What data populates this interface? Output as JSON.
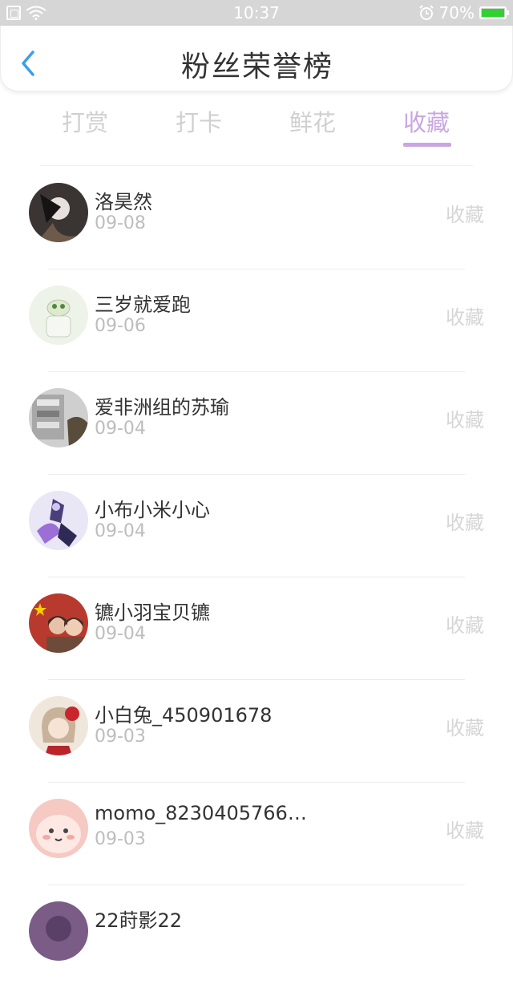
{
  "status_bar": {
    "time": "10:37",
    "battery": "70%",
    "icons": [
      "sim-icon",
      "wifi-icon",
      "alarm-icon",
      "battery-charging-icon"
    ]
  },
  "header": {
    "title": "粉丝荣誉榜",
    "back_icon": "chevron-left-icon",
    "accent_color": "#3aa0e8"
  },
  "tabs": {
    "active_index": 3,
    "active_color": "#c9a6e0",
    "items": [
      {
        "label": "打赏"
      },
      {
        "label": "打卡"
      },
      {
        "label": "鲜花"
      },
      {
        "label": "收藏"
      }
    ]
  },
  "fans": [
    {
      "name": "洛昊然",
      "date": "09-08",
      "action": "收藏"
    },
    {
      "name": "三岁就爱跑",
      "date": "09-06",
      "action": "收藏"
    },
    {
      "name": "爱非洲组的苏瑜",
      "date": "09-04",
      "action": "收藏"
    },
    {
      "name": "小布小米小心",
      "date": "09-04",
      "action": "收藏"
    },
    {
      "name": "镳小羽宝贝镳",
      "date": "09-04",
      "action": "收藏"
    },
    {
      "name": "小白兔_450901678",
      "date": "09-03",
      "action": "收藏"
    },
    {
      "name": "momo_8230405766…",
      "date": "09-03",
      "action": "收藏"
    },
    {
      "name": "22莳影22",
      "date": "",
      "action": ""
    }
  ]
}
